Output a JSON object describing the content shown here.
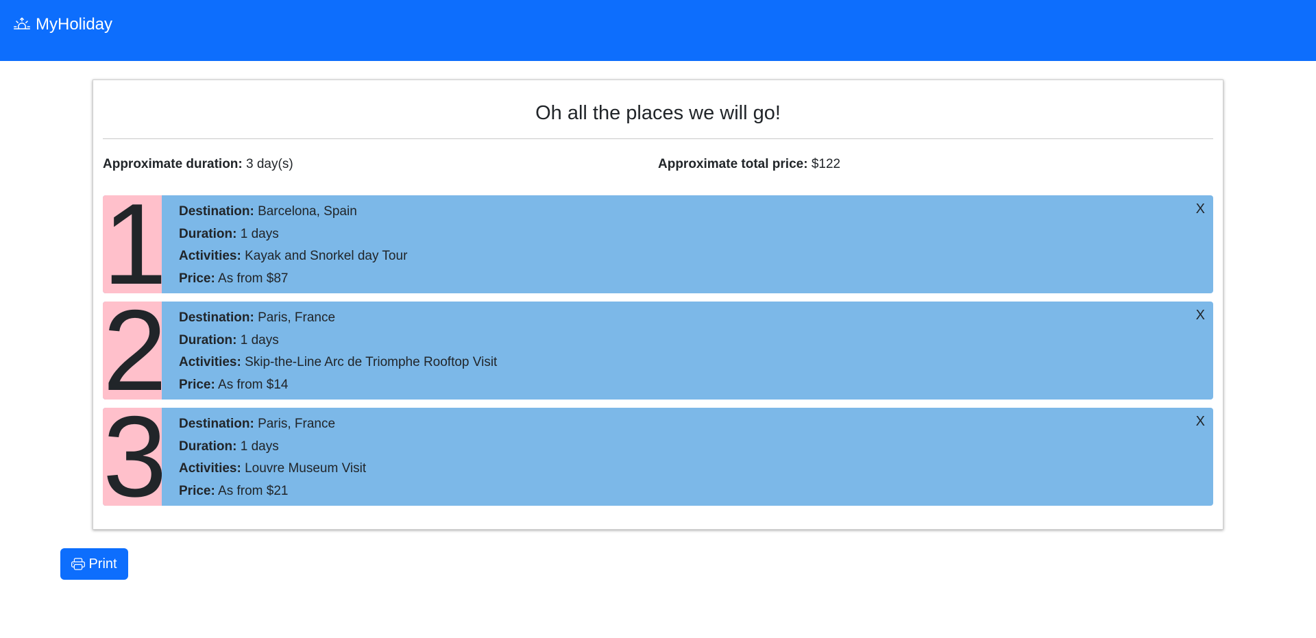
{
  "app": {
    "brand": "MyHoliday",
    "brand_icon": "sunrise-icon",
    "accent_color": "#0d6efd"
  },
  "itinerary": {
    "title": "Oh all the places we will go!",
    "duration_label": "Approximate duration:",
    "duration_value": "3 day(s)",
    "price_label": "Approximate total price:",
    "price_value": "$122",
    "labels": {
      "destination": "Destination:",
      "duration": "Duration:",
      "activities": "Activities:",
      "price": "Price:"
    },
    "remove_label": "X",
    "stops": [
      {
        "number": "1",
        "destination": "Barcelona, Spain",
        "duration": "1 days",
        "activities": "Kayak and Snorkel day Tour",
        "price": "As from $87"
      },
      {
        "number": "2",
        "destination": "Paris, France",
        "duration": "1 days",
        "activities": "Skip-the-Line Arc de Triomphe Rooftop Visit",
        "price": "As from $14"
      },
      {
        "number": "3",
        "destination": "Paris, France",
        "duration": "1 days",
        "activities": "Louvre Museum Visit",
        "price": "As from $21"
      }
    ]
  },
  "actions": {
    "print_label": "Print",
    "print_icon": "printer-icon"
  },
  "colors": {
    "stop_number_bg": "#ffc0cb",
    "stop_body_bg": "#7cb8e8"
  }
}
